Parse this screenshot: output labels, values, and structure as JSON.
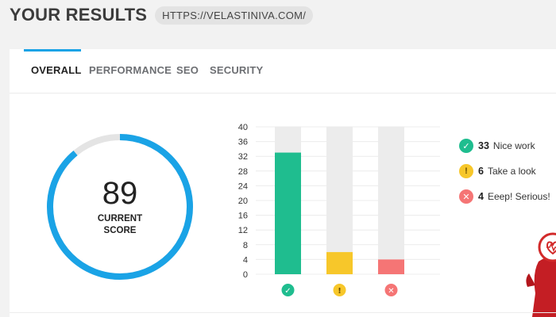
{
  "header": {
    "title": "YOUR RESULTS",
    "url": "HTTPS://VELASTINIVA.COM/"
  },
  "tabs": [
    {
      "label": "OVERALL",
      "active": true
    },
    {
      "label": "PERFORMANCE",
      "active": false
    },
    {
      "label": "SEO",
      "active": false
    },
    {
      "label": "SECURITY",
      "active": false
    }
  ],
  "score": {
    "value": "89",
    "label_line1": "CURRENT",
    "label_line2": "SCORE",
    "fraction": 0.89
  },
  "legend": [
    {
      "count": "33",
      "label": "Nice work",
      "icon": "check-icon",
      "color": "#1fbd8f"
    },
    {
      "count": "6",
      "label": "Take a look",
      "icon": "exclamation-icon",
      "color": "#f7c72a"
    },
    {
      "count": "4",
      "label": "Eeep! Serious!",
      "icon": "x-icon",
      "color": "#f57575"
    }
  ],
  "colors": {
    "accent": "#1aa3e6",
    "track": "#e4e4e4",
    "pass": "#1fbd8f",
    "warn": "#f7c72a",
    "fail": "#f57575"
  },
  "chart_data": {
    "type": "bar",
    "categories": [
      "pass",
      "warning",
      "fail"
    ],
    "values": [
      33,
      6,
      4
    ],
    "colors": [
      "#1fbd8f",
      "#f7c72a",
      "#f57575"
    ],
    "icons": [
      "check-icon",
      "exclamation-icon",
      "x-icon"
    ],
    "ylim": [
      0,
      40
    ],
    "yticks": [
      0,
      4,
      8,
      12,
      16,
      20,
      24,
      28,
      32,
      36,
      40
    ],
    "grid": true
  }
}
